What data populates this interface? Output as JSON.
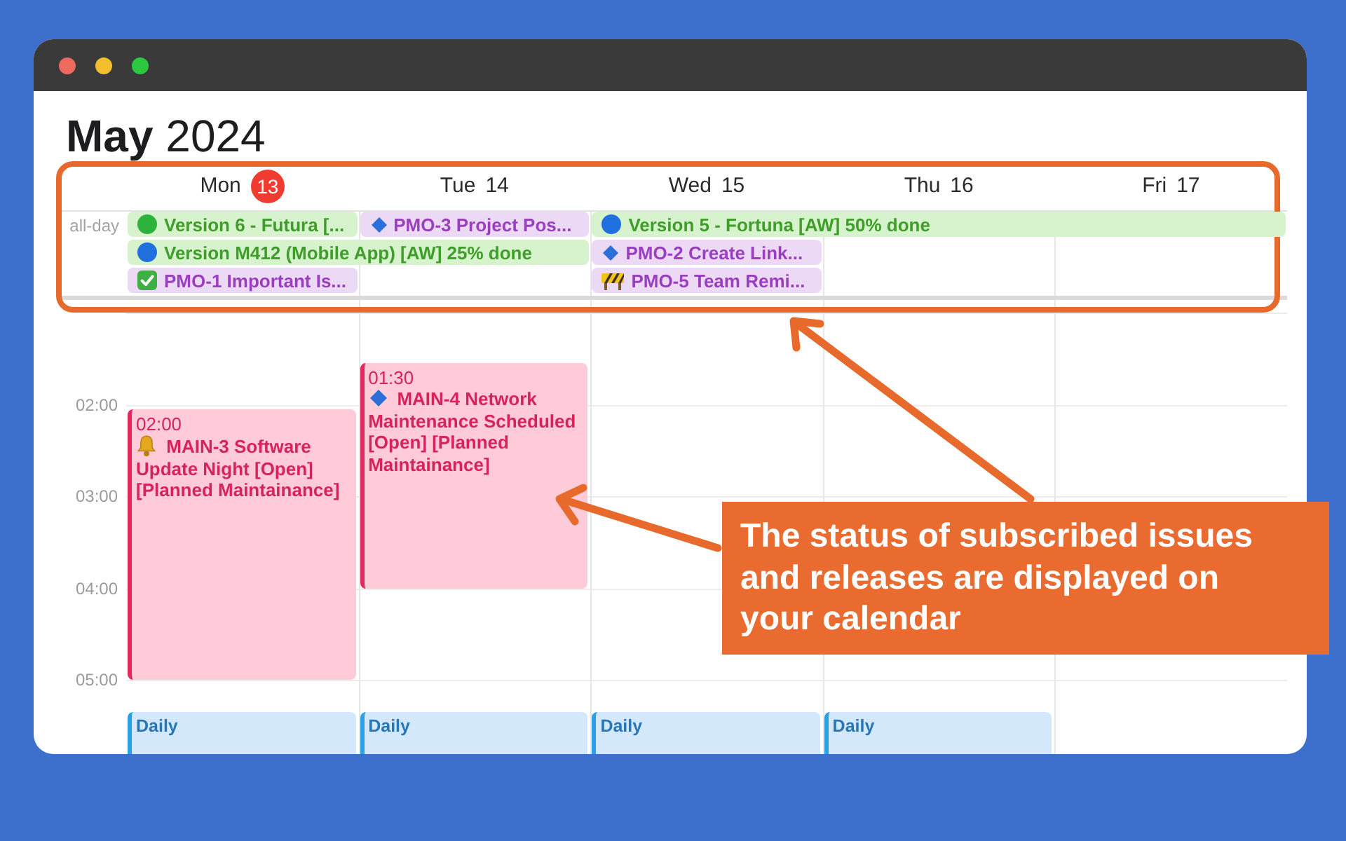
{
  "title": "**May** 2024",
  "days": [
    {
      "name": "Mon",
      "date": "13",
      "today": true,
      "events": [
        {
          "kind": "reminder",
          "time": "02:00",
          "title": "MAIN-3 Software Update Night [Open] [Planned Maintainance]"
        },
        {
          "kind": "routine",
          "title": "Daily"
        }
      ]
    },
    {
      "name": "Tue",
      "date": "14",
      "today": false,
      "events": [
        {
          "kind": "issue",
          "time": "01:30",
          "title": "MAIN-4 Network Maintenance Scheduled [Open] [Planned Maintainance]"
        },
        {
          "kind": "routine",
          "title": "Daily"
        }
      ]
    },
    {
      "name": "Wed",
      "date": "15",
      "today": false,
      "events": [
        {
          "kind": "routine",
          "title": "Daily"
        }
      ]
    },
    {
      "name": "Thu",
      "date": "16",
      "today": false,
      "events": [
        {
          "kind": "routine",
          "title": "Daily"
        }
      ]
    },
    {
      "name": "Fri",
      "date": "17",
      "today": false
    }
  ],
  "all_day": {
    "label": "all-day",
    "rows": [
      [
        {
          "kind": "release",
          "color": "#2db33c",
          "title": "Version 6 - Futura [..."
        },
        {
          "kind": "issue",
          "title": "PMO-3 Project Pos..."
        },
        {
          "kind": "release",
          "color": "#1f6fdf",
          "title": "Version 5 - Fortuna [AW] 50% done"
        },
        {
          "kind": "continued"
        },
        {
          "kind": "continued"
        }
      ],
      [
        {
          "kind": "release",
          "color": "#1f6fdf",
          "title": "Version M412 (Mobile App) [AW] 25% done"
        },
        {
          "kind": "continued"
        },
        {
          "kind": "issue",
          "title": "PMO-2 Create Link..."
        }
      ],
      [
        {
          "kind": "done",
          "title": "PMO-1 Important Is..."
        },
        {
          "kind": "empty"
        },
        {
          "kind": "blocked",
          "title": "PMO-5 Team Remi..."
        }
      ]
    ]
  },
  "hours": [
    "02:00",
    "03:00",
    "04:00",
    "05:00"
  ],
  "annotation": {
    "text": "The status of subscribed issues and releases are displayed on your calendar"
  }
}
